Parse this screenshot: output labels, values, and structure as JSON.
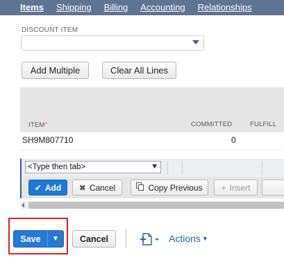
{
  "tabs": [
    {
      "label": "Items"
    },
    {
      "label": "Shipping"
    },
    {
      "label": "Billing"
    },
    {
      "label": "Accounting"
    },
    {
      "label": "Relationships"
    }
  ],
  "discount_item": {
    "label": "DISCOUNT ITEM",
    "value": ""
  },
  "buttons": {
    "add_multiple": "Add Multiple",
    "clear_all_lines": "Clear All Lines"
  },
  "sublist": {
    "columns": {
      "item": "ITEM",
      "required_marker": "*",
      "committed": "COMMITTED",
      "fulfilled": "FULFILL"
    },
    "rows": [
      {
        "item": "SH9M807710",
        "committed": "0"
      }
    ],
    "edit_row": {
      "item_placeholder": "<Type then tab>"
    },
    "actions": {
      "add": "Add",
      "cancel": "Cancel",
      "copy_previous": "Copy Previous",
      "insert": "Insert"
    }
  },
  "footer": {
    "save": "Save",
    "cancel": "Cancel",
    "actions": "Actions"
  },
  "colors": {
    "tabbar": "#5f7393",
    "primary": "#2679d4",
    "highlight": "#e02020",
    "link": "#2a62b8"
  }
}
